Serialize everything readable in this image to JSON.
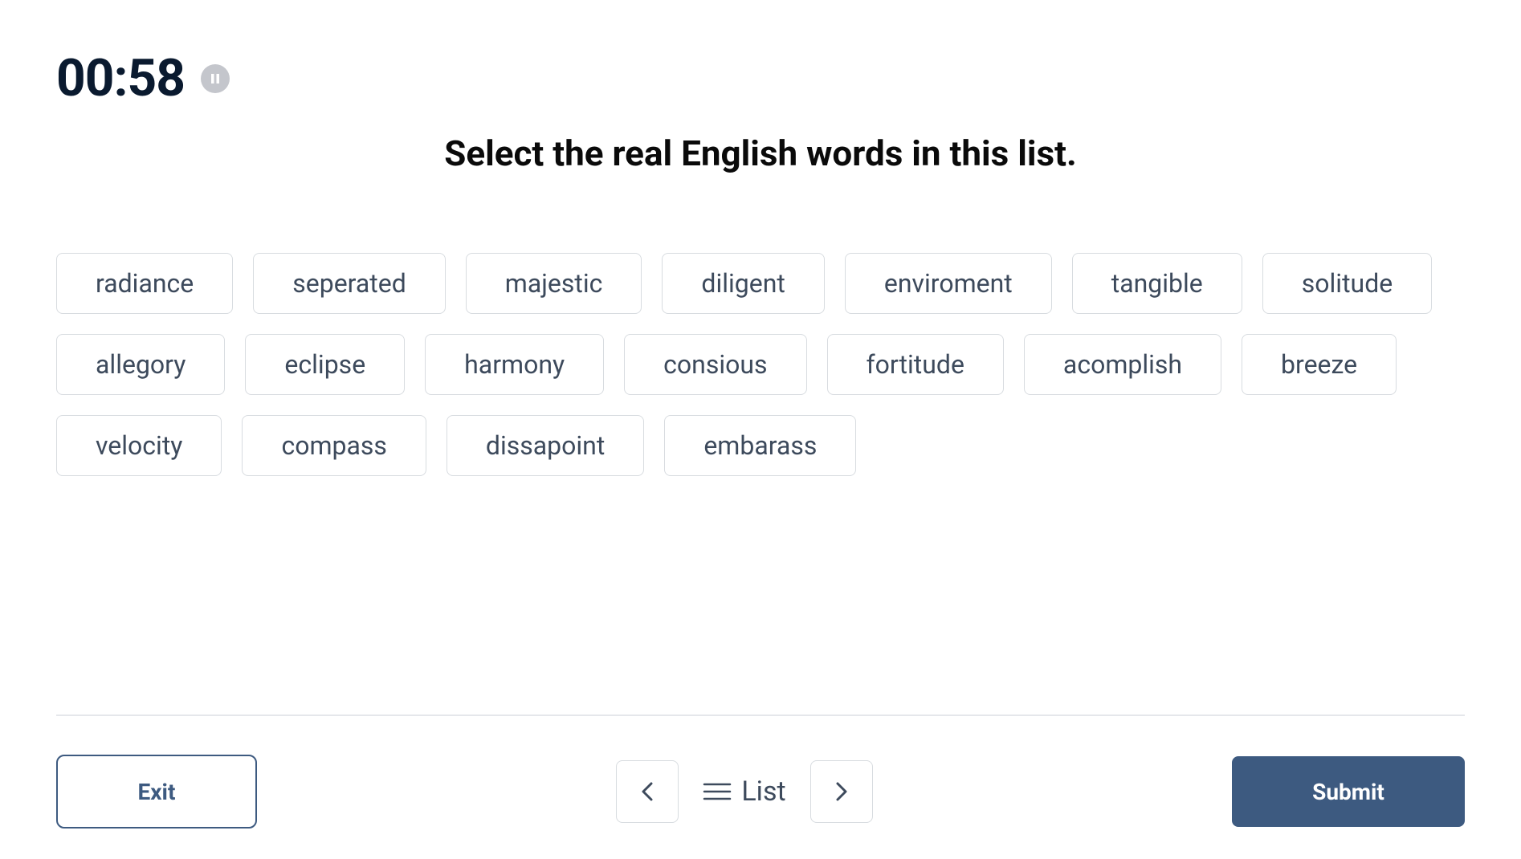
{
  "timer": {
    "value": "00:58"
  },
  "instruction": "Select the real English words in this list.",
  "words": [
    "radiance",
    "seperated",
    "majestic",
    "diligent",
    "enviroment",
    "tangible",
    "solitude",
    "allegory",
    "eclipse",
    "harmony",
    "consious",
    "fortitude",
    "acomplish",
    "breeze",
    "velocity",
    "compass",
    "dissapoint",
    "embarass"
  ],
  "footer": {
    "exit_label": "Exit",
    "list_label": "List",
    "submit_label": "Submit"
  }
}
